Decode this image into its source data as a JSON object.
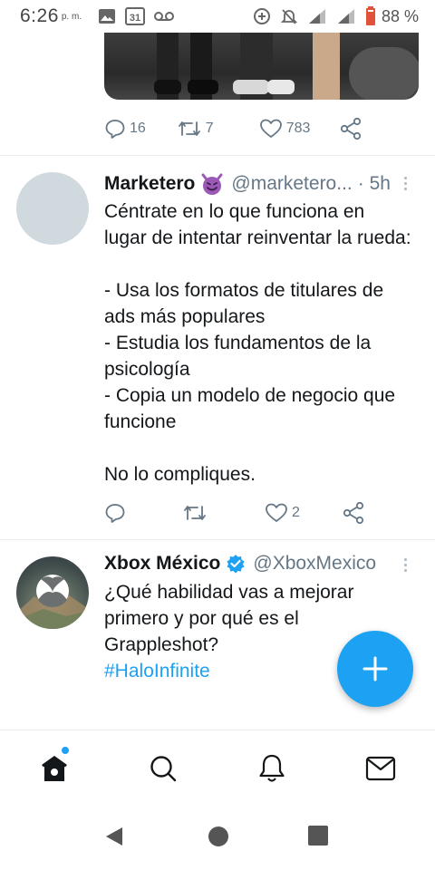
{
  "status_bar": {
    "time": "6:26",
    "ampm": "p. m.",
    "battery": "88 %",
    "icons": [
      "image-icon",
      "calendar-31-icon",
      "voicemail-icon",
      "data-saver-icon",
      "mute-icon",
      "signal-icon",
      "signal-icon-2",
      "battery-icon"
    ]
  },
  "tweet_1": {
    "replies": "16",
    "retweets": "7",
    "likes": "783"
  },
  "tweet_2": {
    "name": "Marketero",
    "emoji": "smiling-devil-emoji",
    "handle": "@marketero...",
    "time": "· 5h",
    "lines": [
      "Céntrate en lo que funciona en",
      "lugar de intentar reinventar la rueda:",
      "",
      "- Usa los formatos de  titulares de",
      "ads más populares",
      "- Estudia los fundamentos de la",
      "psicología",
      "- Copia un modelo de negocio que",
      "funcione",
      "",
      "No lo compliques."
    ],
    "likes": "2"
  },
  "tweet_3": {
    "name": "Xbox México",
    "handle": "@XboxMexico",
    "lines": [
      "¿Qué habilidad vas a mejorar",
      "primero y por qué es el",
      "Grappleshot?"
    ],
    "hashtag": "#HaloInfinite"
  },
  "fab": {
    "icon": "plus-icon",
    "color": "#1da1f2"
  },
  "bottom_nav": [
    "home-icon",
    "search-icon",
    "notifications-icon",
    "messages-icon"
  ],
  "android_nav": [
    "back-icon",
    "home-circle-icon",
    "recents-icon"
  ],
  "colors": {
    "accent": "#1da1f2",
    "secondary_text": "#657786",
    "divider": "#e6ecf0"
  }
}
